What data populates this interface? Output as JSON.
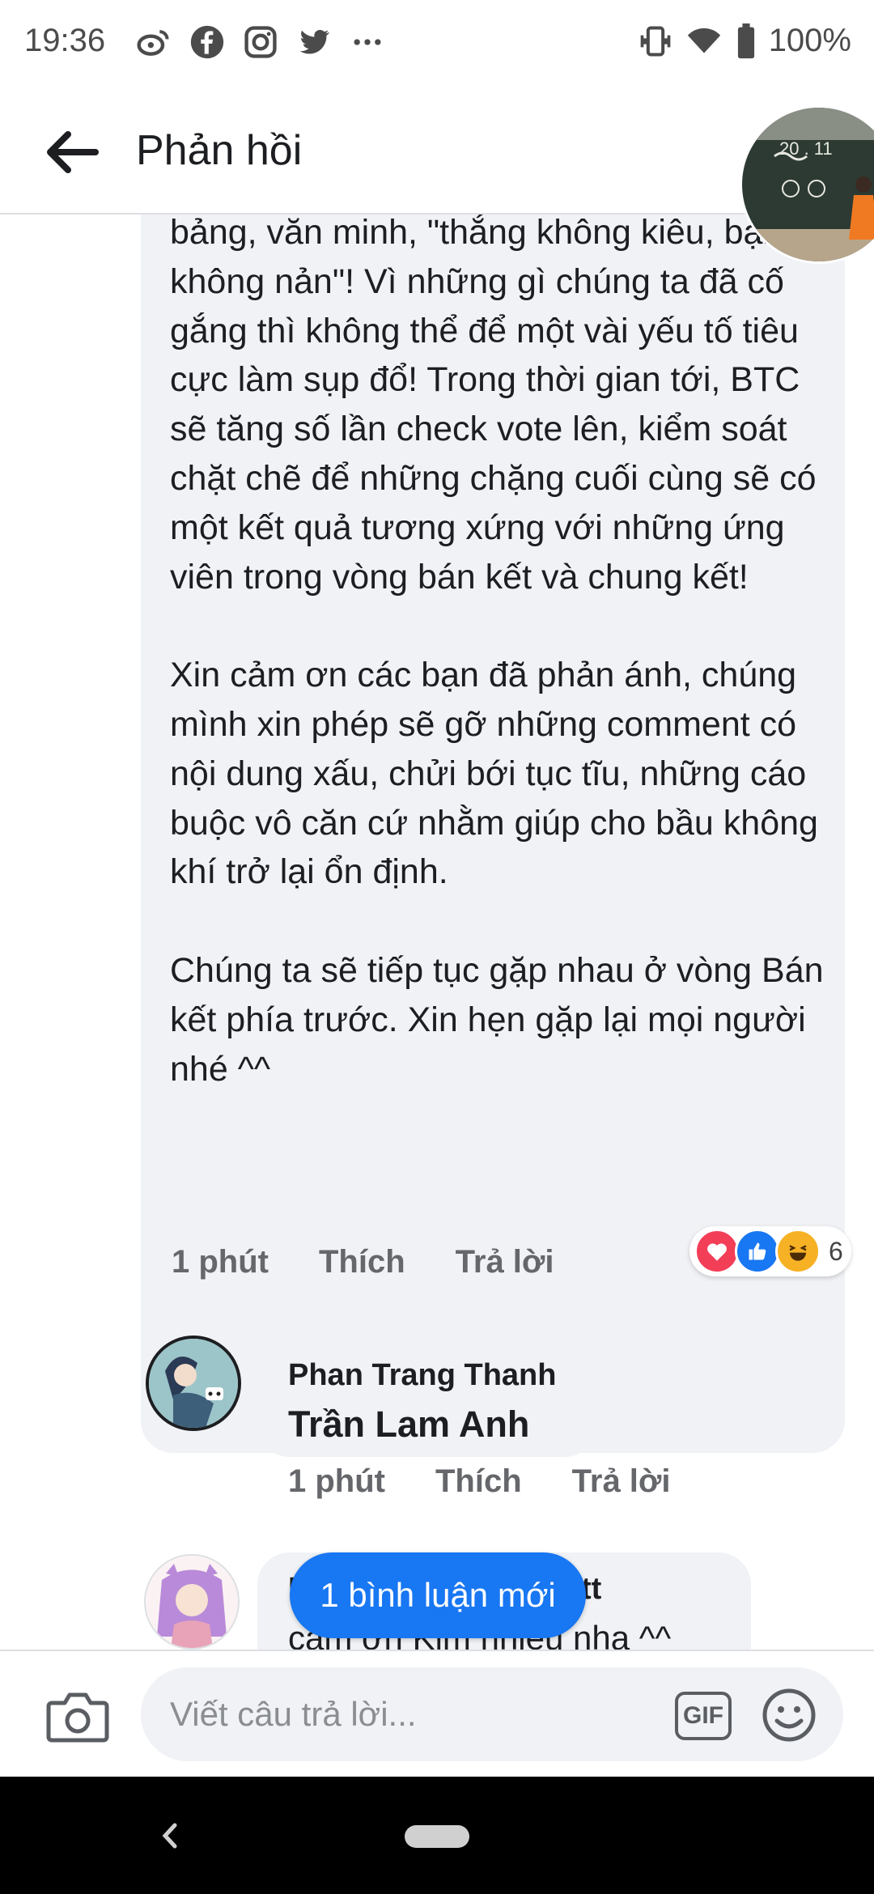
{
  "status_bar": {
    "time": "19:36",
    "battery": "100%",
    "left_icons": [
      "weibo-icon",
      "facebook-icon",
      "instagram-icon",
      "twitter-icon",
      "more-icon"
    ],
    "right_icons": [
      "vibrate-icon",
      "wifi-icon",
      "battery-icon"
    ]
  },
  "header": {
    "title": "Phản hồi"
  },
  "main_comment": {
    "text": "bảng, văn minh, \"thắng không kiêu, bại không nản\"! Vì những gì chúng ta đã cố gắng thì không thể để một vài yếu tố tiêu cực làm sụp đổ! Trong thời gian tới, BTC sẽ tăng số lần check vote lên, kiểm soát chặt chẽ để những chặng cuối cùng sẽ có một kết quả tương xứng với những ứng viên trong vòng bán kết và chung kết!\n\nXin cảm ơn các bạn đã phản ánh, chúng mình xin phép sẽ gỡ những comment có nội dung xấu, chửi bới tục tĩu, những cáo buộc vô căn cứ nhằm giúp cho bầu không khí trở lại ổn định.\n\nChúng ta sẽ tiếp tục gặp nhau ở vòng Bán kết phía trước. Xin hẹn gặp lại mọi người nhé ^^",
    "time": "1 phút",
    "like_label": "Thích",
    "reply_label": "Trả lời",
    "reactions": {
      "types": [
        "love",
        "like",
        "haha"
      ],
      "count": "6",
      "colors": {
        "love": "#f33e58",
        "like": "#1877f2",
        "haha": "#f7b125"
      }
    }
  },
  "replies": [
    {
      "author": "Phan Trang Thanh",
      "text": "Trần Lam Anh",
      "time": "1 phút",
      "like_label": "Thích",
      "reply_label": "Trả lời"
    },
    {
      "author_partial_start": "P",
      "author_partial_end": "tt",
      "text": "cảm ơn Kim nhiều nha ^^"
    }
  ],
  "new_comments_pill": "1 bình luận mới",
  "composer": {
    "placeholder": "Viết câu trả lời...",
    "gif_label": "GIF"
  },
  "colors": {
    "accent": "#1877f2",
    "bubble_bg": "#f0f2f5",
    "secondary_text": "#65676b"
  }
}
